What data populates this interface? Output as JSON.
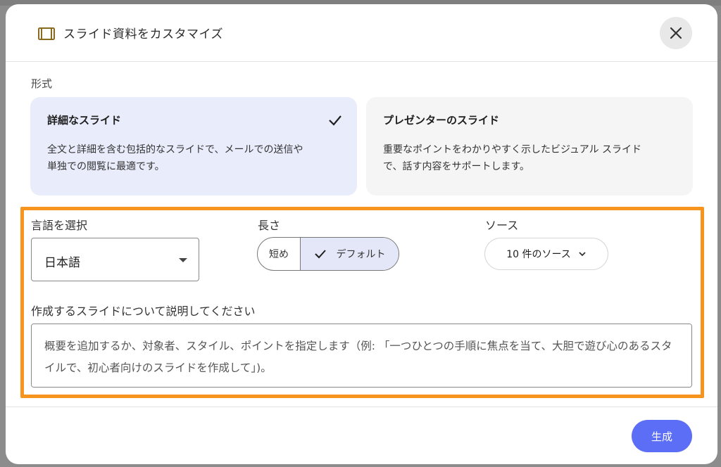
{
  "header": {
    "title": "スライド資料をカスタマイズ"
  },
  "format": {
    "label": "形式",
    "cards": [
      {
        "title": "詳細なスライド",
        "desc_line1": "全文と詳細を含む包括的なスライドで、メールでの送信や",
        "desc_line2": "単独での閲覧に最適です。",
        "selected": true
      },
      {
        "title": "プレゼンターのスライド",
        "desc_line1": "重要なポイントをわかりやすく示したビジュアル スライド",
        "desc_line2": "で、話す内容をサポートします。",
        "selected": false
      }
    ]
  },
  "language": {
    "label": "言語を選択",
    "value": "日本語"
  },
  "length": {
    "label": "長さ",
    "options": [
      "短め",
      "デフォルト"
    ],
    "selected": "デフォルト"
  },
  "source": {
    "label": "ソース",
    "button": "10 件のソース"
  },
  "description": {
    "label": "作成するスライドについて説明してください",
    "placeholder": "概要を追加するか、対象者、スタイル、ポイントを指定します（例: 「一つひとつの手順に焦点を当て、大胆で遊び心のあるスタイルで、初心者向けのスライドを作成して」)。"
  },
  "footer": {
    "generate": "生成"
  },
  "colors": {
    "accent": "#5b6ef5",
    "selected_card": "#e9ecfb",
    "highlight": "#f7941d"
  }
}
